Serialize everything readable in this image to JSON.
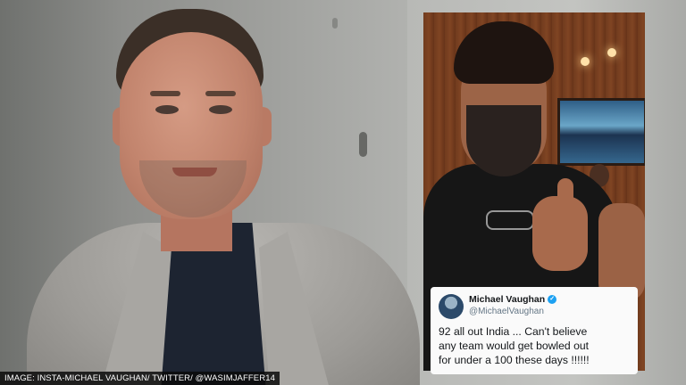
{
  "caption": "IMAGE: INSTA-MICHAEL VAUGHAN/ TWITTER/ @WASIMJAFFER14",
  "tweet": {
    "name": "Michael Vaughan",
    "verified_icon": "verified-badge-icon",
    "handle": "@MichaelVaughan",
    "lines": [
      "92 all out India ... Can't believe",
      "any team would get bowled out",
      "for under a 100 these days !!!!!!"
    ]
  },
  "colors": {
    "verified_blue": "#1da1f2",
    "caption_bg": "#0a0a0a",
    "tweet_bg": "#fafafa"
  }
}
